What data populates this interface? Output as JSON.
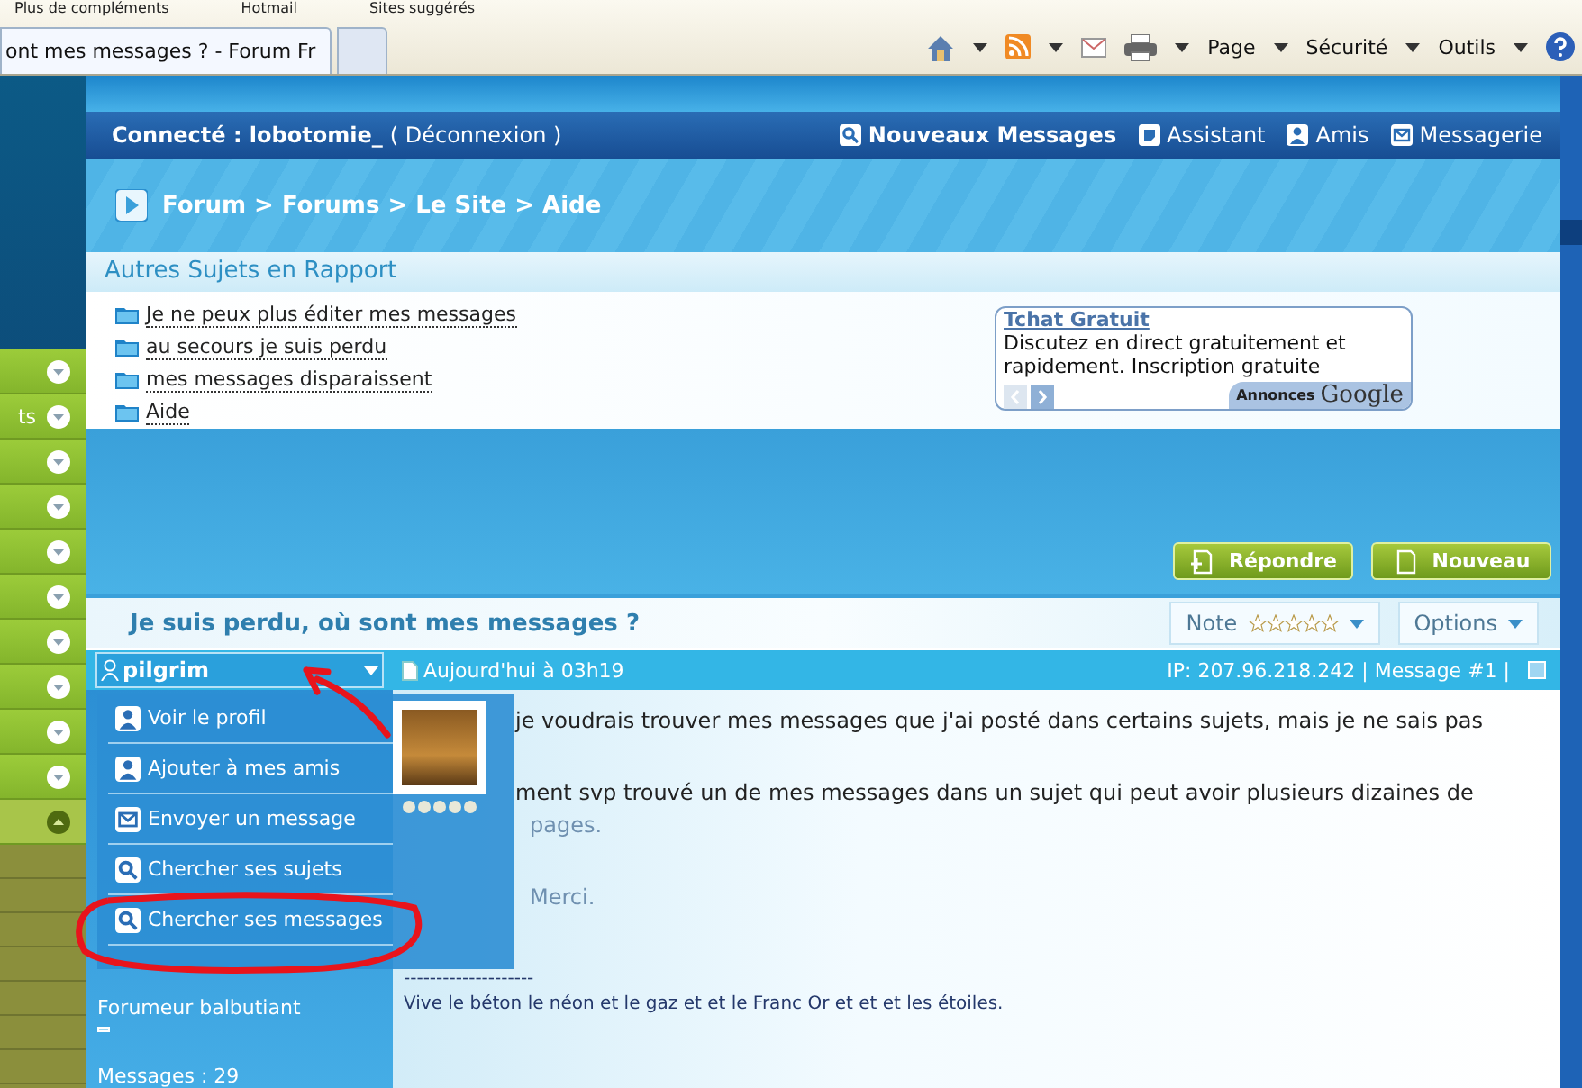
{
  "browser": {
    "favorites": [
      "Plus de compléments",
      "Hotmail",
      "Sites suggérés"
    ],
    "tab": {
      "title": "ont mes messages ? - Forum Fr",
      "selected": true
    },
    "toolbar": [
      "Page",
      "Sécurité",
      "Outils"
    ]
  },
  "sidebar": {
    "items": [
      {
        "expanded": false
      },
      {
        "label": "ts",
        "expanded": false
      },
      {
        "expanded": false
      },
      {
        "expanded": false
      },
      {
        "expanded": false
      },
      {
        "expanded": false
      },
      {
        "expanded": false
      },
      {
        "expanded": false
      },
      {
        "expanded": false
      },
      {
        "expanded": false
      },
      {
        "expanded": true
      }
    ]
  },
  "header": {
    "user": "Connecté : lobotomie_",
    "logout": "( Déconnexion )",
    "links": [
      {
        "label": "Nouveaux Messages",
        "kind": "search",
        "bold": true
      },
      {
        "label": "Assistant",
        "kind": "note",
        "bold": false
      },
      {
        "label": "Amis",
        "kind": "user",
        "bold": false
      },
      {
        "label": "Messagerie",
        "kind": "mail",
        "bold": false
      }
    ]
  },
  "breadcrumb": "Forum > Forums > Le Site > Aide",
  "related": {
    "title": "Autres Sujets en Rapport",
    "links": [
      "Je ne peux plus éditer mes messages",
      "au secours je suis perdu",
      "mes messages disparaissent",
      "Aide"
    ]
  },
  "ad": {
    "title": "Tchat Gratuit",
    "text": "Discutez en direct gratuitement et rapidement. Inscription gratuite",
    "label": "Annonces",
    "brand": "Google"
  },
  "actions": [
    {
      "label": "Répondre",
      "kind": "reply"
    },
    {
      "label": "Nouveau",
      "kind": "new"
    }
  ],
  "topic": {
    "title": "Je suis perdu, où sont mes messages ?",
    "rating_label": "Note",
    "stars": 0,
    "options": "Options"
  },
  "post": {
    "author": "pilgrim",
    "date": "Aujourd'hui à 03h19",
    "meta": "IP: 207.96.218.242 | Message #1 |",
    "rank": "Forumeur balbutiant",
    "count": "Messages : 29",
    "body": [
      "je voudrais trouver mes messages que j'ai posté dans certains sujets, mais je ne sais pas",
      "ment svp trouvé un de mes messages dans un sujet qui peut avoir plusieurs dizaines de",
      "pages.",
      "Merci."
    ],
    "signature_rule": "--------------------",
    "signature": "Vive le béton le néon et le gaz et et le Franc Or et et et les étoiles."
  },
  "user_menu": {
    "open": true,
    "items": [
      {
        "label": "Voir le profil",
        "kind": "user"
      },
      {
        "label": "Ajouter à mes amis",
        "kind": "user"
      },
      {
        "label": "Envoyer un message",
        "kind": "mail"
      },
      {
        "label": "Chercher ses sujets",
        "kind": "search"
      },
      {
        "label": "Chercher ses messages",
        "kind": "search"
      }
    ]
  }
}
